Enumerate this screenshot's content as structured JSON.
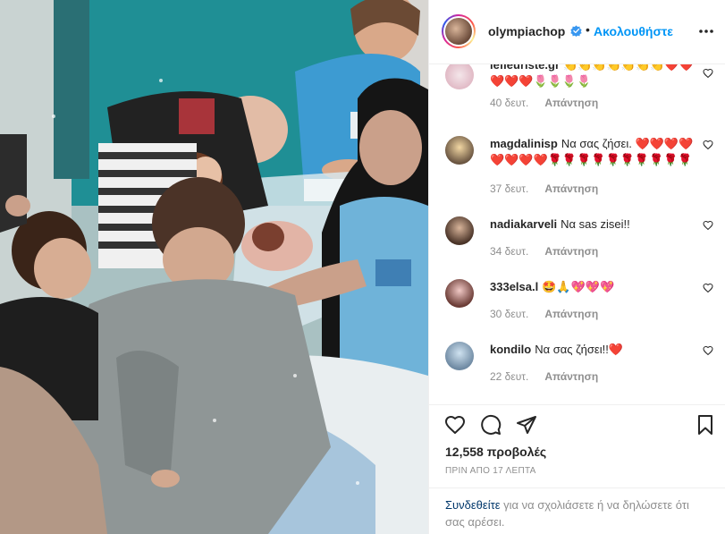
{
  "header": {
    "username": "olympiachop",
    "separator": "•",
    "follow_label": "Ακολουθήστε",
    "verified_icon": "verified-badge-icon",
    "more_icon": "more-options-icon"
  },
  "comments": [
    {
      "user": "lefleuriste.gr",
      "text": "👏👏👏👏👏👏👏❤️❤️❤️❤️❤️🌷🌷🌷🌷",
      "time": "40 δευτ.",
      "reply": "Απάντηση"
    },
    {
      "user": "magdalinisp",
      "text": "Να σας ζήσει. ❤️❤️❤️❤️❤️❤️❤️❤️🌹🌹🌹🌹🌹🌹🌹🌹🌹🌹",
      "time": "37 δευτ.",
      "reply": "Απάντηση"
    },
    {
      "user": "nadiakarveli",
      "text": "Να sas zisei!!",
      "time": "34 δευτ.",
      "reply": "Απάντηση"
    },
    {
      "user": "333elsa.l",
      "text": "🤩🙏💖💖💖",
      "time": "30 δευτ.",
      "reply": "Απάντηση"
    },
    {
      "user": "kondilo",
      "text": "Να σας ζήσει!!❤️",
      "time": "22 δευτ.",
      "reply": "Απάντηση"
    }
  ],
  "actions": {
    "like_icon": "heart-icon",
    "comment_icon": "comment-icon",
    "share_icon": "paper-plane-icon",
    "save_icon": "bookmark-icon"
  },
  "stats": {
    "views": "12,558 προβολές",
    "time_ago": "ΠΡΙΝ ΑΠΟ 17 ΛΕΠΤΑ"
  },
  "login": {
    "link": "Συνδεθείτε",
    "rest": " για να σχολιάσετε ή να δηλώσετε ότι σας αρέσει."
  },
  "colors": {
    "accent": "#0095f6",
    "verified": "#3897f0",
    "muted": "#8e8e8e",
    "text": "#262626"
  }
}
